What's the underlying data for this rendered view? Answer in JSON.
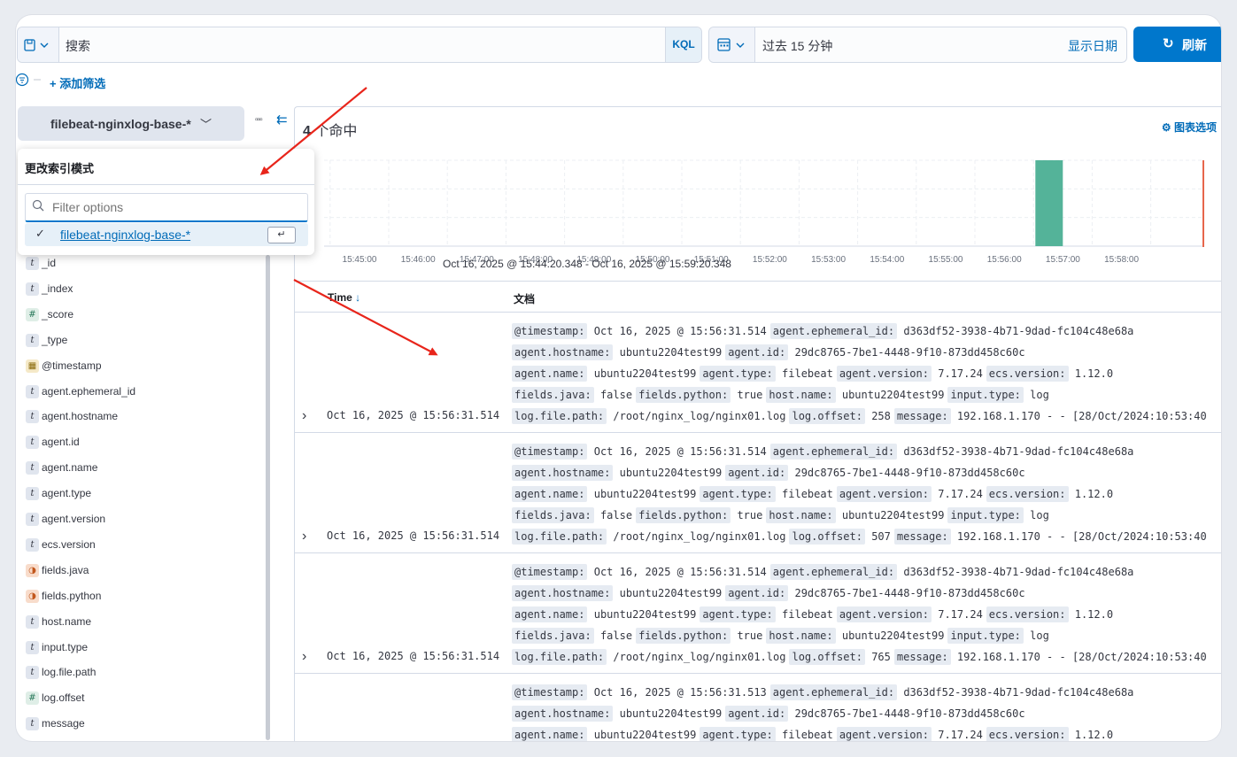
{
  "querybar": {
    "search_placeholder": "搜索",
    "kql_label": "KQL",
    "time_range": "过去 15 分钟",
    "show_dates": "显示日期",
    "refresh_label": "刷新",
    "add_filter": "+ 添加筛选"
  },
  "sidebar": {
    "index_pattern": "filebeat-nginxlog-base-*",
    "popover": {
      "title": "更改索引模式",
      "filter_placeholder": "Filter options",
      "option": "filebeat-nginxlog-base-*"
    },
    "fields": [
      {
        "type": "t",
        "name": "_id"
      },
      {
        "type": "t",
        "name": "_index"
      },
      {
        "type": "#",
        "name": "_score"
      },
      {
        "type": "t",
        "name": "_type"
      },
      {
        "type": "date",
        "name": "@timestamp"
      },
      {
        "type": "t",
        "name": "agent.ephemeral_id"
      },
      {
        "type": "t",
        "name": "agent.hostname"
      },
      {
        "type": "t",
        "name": "agent.id"
      },
      {
        "type": "t",
        "name": "agent.name"
      },
      {
        "type": "t",
        "name": "agent.type"
      },
      {
        "type": "t",
        "name": "agent.version"
      },
      {
        "type": "t",
        "name": "ecs.version"
      },
      {
        "type": "bool",
        "name": "fields.java"
      },
      {
        "type": "bool",
        "name": "fields.python"
      },
      {
        "type": "t",
        "name": "host.name"
      },
      {
        "type": "t",
        "name": "input.type"
      },
      {
        "type": "t",
        "name": "log.file.path"
      },
      {
        "type": "#",
        "name": "log.offset"
      },
      {
        "type": "t",
        "name": "message"
      }
    ]
  },
  "main": {
    "hits_count": "4",
    "hits_label": " 个命中",
    "chart_options": "图表选项",
    "range_label": "Oct 16, 2025 @ 15:44:20.348 - Oct 16, 2025 @ 15:59:20.348",
    "col_time": "Time",
    "col_doc": "文档"
  },
  "chart_data": {
    "type": "bar",
    "categories": [
      "15:45:00",
      "15:46:00",
      "15:47:00",
      "15:48:00",
      "15:49:00",
      "15:50:00",
      "15:51:00",
      "15:52:00",
      "15:53:00",
      "15:54:00",
      "15:55:00",
      "15:56:00",
      "15:57:00",
      "15:58:00"
    ],
    "values": [
      0,
      0,
      0,
      0,
      0,
      0,
      0,
      0,
      0,
      0,
      0,
      0,
      4,
      0
    ],
    "bar_start": "15:56:30",
    "bar_value": 4,
    "color": "#54b399",
    "grid": true
  },
  "rows": [
    {
      "time": "Oct 16, 2025 @ 15:56:31.514",
      "lines": [
        [
          [
            "@timestamp:",
            "Oct 16, 2025 @ 15:56:31.514"
          ],
          [
            "agent.ephemeral_id:",
            "d363df52-3938-4b71-9dad-fc104c48e68a"
          ]
        ],
        [
          [
            "agent.hostname:",
            "ubuntu2204test99"
          ],
          [
            "agent.id:",
            "29dc8765-7be1-4448-9f10-873dd458c60c"
          ]
        ],
        [
          [
            "agent.name:",
            "ubuntu2204test99"
          ],
          [
            "agent.type:",
            "filebeat"
          ],
          [
            "agent.version:",
            "7.17.24"
          ],
          [
            "ecs.version:",
            "1.12.0"
          ]
        ],
        [
          [
            "fields.java:",
            "false"
          ],
          [
            "fields.python:",
            "true"
          ],
          [
            "host.name:",
            "ubuntu2204test99"
          ],
          [
            "input.type:",
            "log"
          ]
        ],
        [
          [
            "log.file.path:",
            "/root/nginx_log/nginx01.log"
          ],
          [
            "log.offset:",
            "258"
          ],
          [
            "message:",
            "192.168.1.170 - - [28/Oct/2024:10:53:40"
          ]
        ]
      ]
    },
    {
      "time": "Oct 16, 2025 @ 15:56:31.514",
      "lines": [
        [
          [
            "@timestamp:",
            "Oct 16, 2025 @ 15:56:31.514"
          ],
          [
            "agent.ephemeral_id:",
            "d363df52-3938-4b71-9dad-fc104c48e68a"
          ]
        ],
        [
          [
            "agent.hostname:",
            "ubuntu2204test99"
          ],
          [
            "agent.id:",
            "29dc8765-7be1-4448-9f10-873dd458c60c"
          ]
        ],
        [
          [
            "agent.name:",
            "ubuntu2204test99"
          ],
          [
            "agent.type:",
            "filebeat"
          ],
          [
            "agent.version:",
            "7.17.24"
          ],
          [
            "ecs.version:",
            "1.12.0"
          ]
        ],
        [
          [
            "fields.java:",
            "false"
          ],
          [
            "fields.python:",
            "true"
          ],
          [
            "host.name:",
            "ubuntu2204test99"
          ],
          [
            "input.type:",
            "log"
          ]
        ],
        [
          [
            "log.file.path:",
            "/root/nginx_log/nginx01.log"
          ],
          [
            "log.offset:",
            "507"
          ],
          [
            "message:",
            "192.168.1.170 - - [28/Oct/2024:10:53:40"
          ]
        ]
      ]
    },
    {
      "time": "Oct 16, 2025 @ 15:56:31.514",
      "lines": [
        [
          [
            "@timestamp:",
            "Oct 16, 2025 @ 15:56:31.514"
          ],
          [
            "agent.ephemeral_id:",
            "d363df52-3938-4b71-9dad-fc104c48e68a"
          ]
        ],
        [
          [
            "agent.hostname:",
            "ubuntu2204test99"
          ],
          [
            "agent.id:",
            "29dc8765-7be1-4448-9f10-873dd458c60c"
          ]
        ],
        [
          [
            "agent.name:",
            "ubuntu2204test99"
          ],
          [
            "agent.type:",
            "filebeat"
          ],
          [
            "agent.version:",
            "7.17.24"
          ],
          [
            "ecs.version:",
            "1.12.0"
          ]
        ],
        [
          [
            "fields.java:",
            "false"
          ],
          [
            "fields.python:",
            "true"
          ],
          [
            "host.name:",
            "ubuntu2204test99"
          ],
          [
            "input.type:",
            "log"
          ]
        ],
        [
          [
            "log.file.path:",
            "/root/nginx_log/nginx01.log"
          ],
          [
            "log.offset:",
            "765"
          ],
          [
            "message:",
            "192.168.1.170 - - [28/Oct/2024:10:53:40"
          ]
        ]
      ]
    },
    {
      "time": "",
      "lines": [
        [
          [
            "@timestamp:",
            "Oct 16, 2025 @ 15:56:31.513"
          ],
          [
            "agent.ephemeral_id:",
            "d363df52-3938-4b71-9dad-fc104c48e68a"
          ]
        ],
        [
          [
            "agent.hostname:",
            "ubuntu2204test99"
          ],
          [
            "agent.id:",
            "29dc8765-7be1-4448-9f10-873dd458c60c"
          ]
        ],
        [
          [
            "agent.name:",
            "ubuntu2204test99"
          ],
          [
            "agent.type:",
            "filebeat"
          ],
          [
            "agent.version:",
            "7.17.24"
          ],
          [
            "ecs.version:",
            "1.12.0"
          ]
        ]
      ]
    }
  ]
}
